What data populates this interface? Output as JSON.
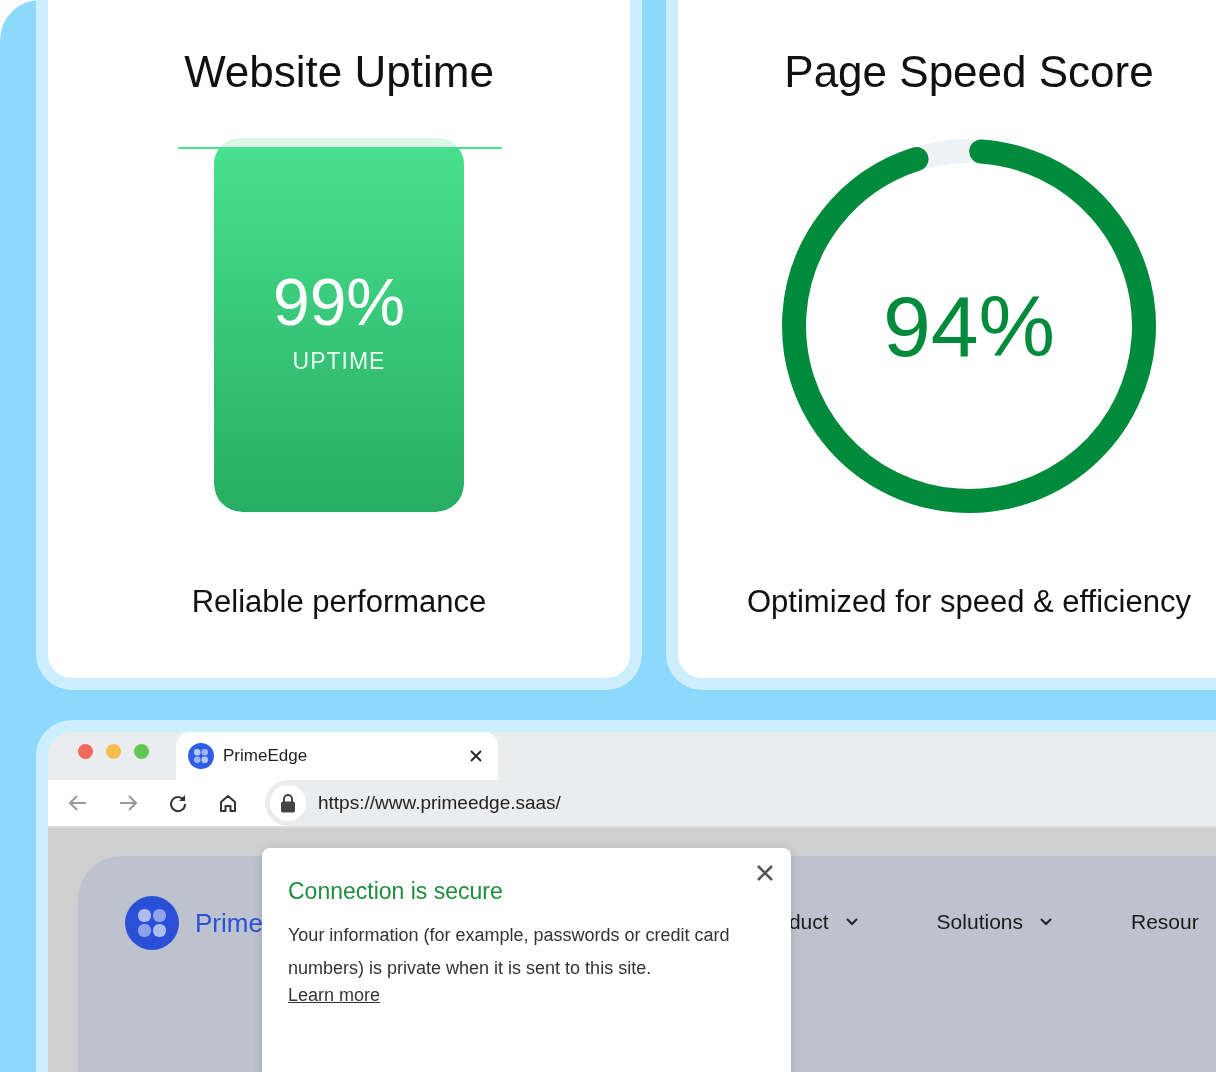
{
  "cards": [
    {
      "kind": "bar",
      "title": "Website Uptime",
      "value": "99%",
      "unit": "UPTIME",
      "level": 0.97,
      "caption": "Reliable performance"
    },
    {
      "kind": "ring",
      "title": "Page Speed Score",
      "value": "94%",
      "level": 0.94,
      "caption": "Optimized for speed & efficiency"
    }
  ],
  "browser": {
    "tab": {
      "title": "PrimeEdge"
    },
    "url": "https://www.primeedge.saas/",
    "site": {
      "brand": "Prime",
      "nav": [
        {
          "label": "duct",
          "chevron": true
        },
        {
          "label": "Solutions",
          "chevron": true
        },
        {
          "label": "Resour",
          "chevron": false
        }
      ]
    },
    "popup": {
      "title": "Connection is secure",
      "body": "Your information (for example, passwords or credit card numbers) is private when it is sent to this site.",
      "link": "Learn more"
    }
  }
}
